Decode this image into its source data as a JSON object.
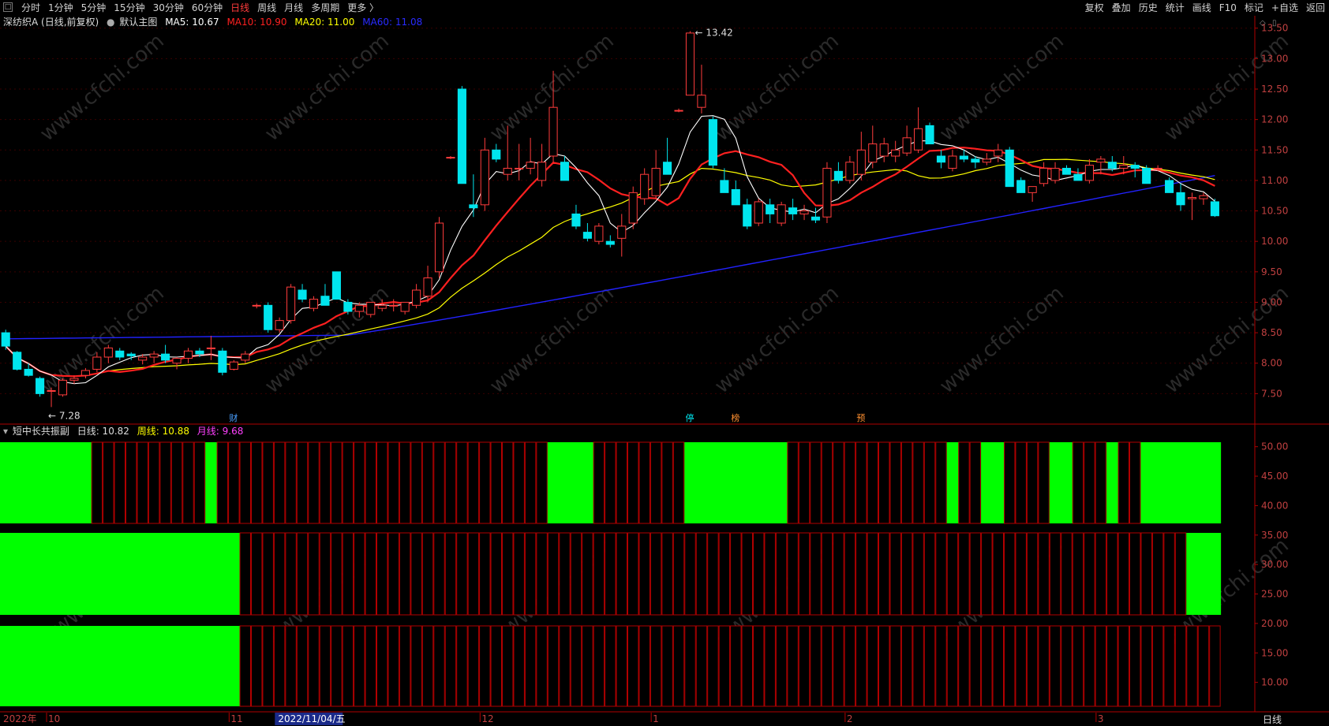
{
  "toolbar": {
    "left_items": [
      "分时",
      "1分钟",
      "5分钟",
      "15分钟",
      "30分钟",
      "60分钟",
      "日线",
      "周线",
      "月线",
      "多周期",
      "更多 〉"
    ],
    "active_item": "日线",
    "right_items": [
      "复权",
      "叠加",
      "历史",
      "统计",
      "画线",
      "F10",
      "标记",
      "+自选",
      "返回"
    ]
  },
  "main_info": {
    "title": "深纺织A (日线,前复权)",
    "template": "默认主图",
    "ma5": "MA5: 10.67",
    "ma10": "MA10: 10.90",
    "ma20": "MA20: 11.00",
    "ma60": "MA60: 11.08"
  },
  "sub_info": {
    "title": "短中长共振副",
    "daily": "日线: 10.82",
    "weekly": "周线: 10.88",
    "monthly": "月线: 9.68"
  },
  "colors": {
    "up": "#ff3c3c",
    "down": "#00e5ee",
    "ma5": "#ffffff",
    "ma10": "#ff2020",
    "ma20": "#ffff00",
    "ma60": "#2222ff",
    "signal": "#00ff00",
    "axis": "#b00000"
  },
  "chart_data": {
    "type": "candlestick",
    "y_ticks": [
      "13.50",
      "13.00",
      "12.50",
      "12.00",
      "11.50",
      "11.00",
      "10.50",
      "10.00",
      "9.50",
      "9.00",
      "8.50",
      "8.00",
      "7.50"
    ],
    "y_range": [
      7.0,
      13.6
    ],
    "annotations": {
      "high": "13.42",
      "low": "7.28"
    },
    "event_labels": [
      "财",
      "停",
      "榜",
      "预"
    ],
    "candles": [
      [
        8.5,
        8.55,
        8.22,
        8.28
      ],
      [
        8.18,
        8.2,
        7.88,
        7.9
      ],
      [
        7.9,
        8.0,
        7.78,
        7.8
      ],
      [
        7.75,
        7.78,
        7.45,
        7.5
      ],
      [
        7.55,
        7.6,
        7.28,
        7.55
      ],
      [
        7.48,
        7.75,
        7.45,
        7.72
      ],
      [
        7.72,
        7.8,
        7.66,
        7.75
      ],
      [
        7.8,
        7.92,
        7.75,
        7.88
      ],
      [
        7.9,
        8.18,
        7.85,
        8.1
      ],
      [
        8.1,
        8.3,
        8.0,
        8.25
      ],
      [
        8.2,
        8.25,
        8.05,
        8.1
      ],
      [
        8.15,
        8.18,
        8.05,
        8.12
      ],
      [
        8.05,
        8.15,
        7.98,
        8.1
      ],
      [
        8.1,
        8.2,
        8.0,
        8.15
      ],
      [
        8.15,
        8.3,
        8.0,
        8.05
      ],
      [
        8.0,
        8.1,
        7.9,
        8.08
      ],
      [
        8.08,
        8.25,
        8.0,
        8.2
      ],
      [
        8.2,
        8.25,
        8.1,
        8.15
      ],
      [
        8.25,
        8.45,
        8.05,
        8.25
      ],
      [
        8.2,
        8.25,
        7.8,
        7.85
      ],
      [
        7.9,
        8.05,
        7.88,
        8.02
      ],
      [
        8.05,
        8.2,
        8.0,
        8.15
      ],
      [
        8.95,
        8.98,
        8.9,
        8.95
      ],
      [
        8.95,
        9.0,
        8.5,
        8.55
      ],
      [
        8.55,
        8.75,
        8.5,
        8.7
      ],
      [
        8.7,
        9.3,
        8.65,
        9.25
      ],
      [
        9.2,
        9.3,
        9.0,
        9.05
      ],
      [
        8.9,
        9.1,
        8.85,
        9.05
      ],
      [
        9.1,
        9.3,
        8.95,
        8.95
      ],
      [
        9.5,
        9.5,
        9.05,
        9.05
      ],
      [
        9.0,
        9.05,
        8.8,
        8.85
      ],
      [
        8.85,
        9.0,
        8.75,
        8.95
      ],
      [
        8.8,
        9.0,
        8.75,
        9.0
      ],
      [
        8.9,
        9.05,
        8.85,
        8.95
      ],
      [
        8.95,
        9.05,
        8.85,
        8.95
      ],
      [
        8.85,
        9.0,
        8.8,
        9.0
      ],
      [
        8.95,
        9.3,
        8.9,
        9.2
      ],
      [
        9.1,
        9.6,
        9.0,
        9.4
      ],
      [
        9.5,
        10.4,
        9.4,
        10.3
      ],
      [
        11.38,
        11.4,
        11.35,
        11.38
      ],
      [
        12.5,
        12.55,
        11.0,
        10.95
      ],
      [
        10.6,
        11.1,
        10.4,
        10.55
      ],
      [
        10.6,
        11.7,
        10.5,
        11.5
      ],
      [
        11.5,
        11.6,
        11.3,
        11.35
      ],
      [
        11.1,
        11.9,
        11.0,
        11.2
      ],
      [
        11.2,
        11.6,
        11.0,
        11.2
      ],
      [
        11.2,
        11.7,
        11.1,
        11.3
      ],
      [
        11.0,
        11.6,
        10.9,
        11.3
      ],
      [
        11.4,
        12.8,
        11.3,
        12.2
      ],
      [
        11.3,
        11.4,
        11.0,
        11.0
      ],
      [
        10.45,
        10.6,
        10.2,
        10.25
      ],
      [
        10.15,
        10.3,
        10.0,
        10.05
      ],
      [
        10.0,
        10.3,
        9.95,
        10.25
      ],
      [
        10.0,
        10.1,
        9.9,
        9.95
      ],
      [
        10.05,
        10.45,
        9.75,
        10.25
      ],
      [
        10.3,
        10.9,
        10.2,
        10.8
      ],
      [
        10.7,
        11.2,
        10.6,
        11.1
      ],
      [
        10.75,
        11.5,
        10.7,
        11.2
      ],
      [
        11.3,
        11.7,
        11.1,
        11.1
      ],
      [
        12.15,
        12.18,
        12.12,
        12.15
      ],
      [
        12.4,
        13.45,
        12.4,
        13.42
      ],
      [
        12.2,
        12.9,
        12.1,
        12.4
      ],
      [
        12.0,
        12.05,
        11.2,
        11.25
      ],
      [
        11.0,
        11.2,
        10.8,
        10.8
      ],
      [
        10.85,
        11.0,
        10.6,
        10.6
      ],
      [
        10.6,
        10.7,
        10.2,
        10.25
      ],
      [
        10.3,
        10.7,
        10.25,
        10.65
      ],
      [
        10.6,
        10.7,
        10.3,
        10.45
      ],
      [
        10.3,
        10.65,
        10.25,
        10.6
      ],
      [
        10.55,
        10.7,
        10.35,
        10.45
      ],
      [
        10.45,
        10.6,
        10.35,
        10.5
      ],
      [
        10.4,
        10.55,
        10.3,
        10.35
      ],
      [
        10.4,
        11.3,
        10.3,
        11.2
      ],
      [
        11.15,
        11.3,
        10.95,
        11.0
      ],
      [
        11.0,
        11.4,
        10.95,
        11.3
      ],
      [
        11.1,
        11.8,
        11.0,
        11.5
      ],
      [
        11.3,
        11.9,
        11.2,
        11.6
      ],
      [
        11.4,
        11.7,
        11.3,
        11.6
      ],
      [
        11.4,
        11.65,
        11.3,
        11.5
      ],
      [
        11.45,
        11.9,
        11.4,
        11.7
      ],
      [
        11.5,
        12.2,
        11.45,
        11.85
      ],
      [
        11.9,
        11.95,
        11.6,
        11.6
      ],
      [
        11.4,
        11.5,
        11.2,
        11.3
      ],
      [
        11.2,
        11.5,
        11.15,
        11.4
      ],
      [
        11.4,
        11.5,
        11.3,
        11.35
      ],
      [
        11.35,
        11.4,
        11.2,
        11.3
      ],
      [
        11.3,
        11.45,
        11.25,
        11.35
      ],
      [
        11.4,
        11.6,
        11.3,
        11.5
      ],
      [
        11.5,
        11.55,
        10.9,
        10.9
      ],
      [
        11.0,
        11.05,
        10.8,
        10.8
      ],
      [
        10.8,
        10.9,
        10.65,
        10.9
      ],
      [
        10.95,
        11.3,
        10.9,
        11.2
      ],
      [
        11.0,
        11.3,
        10.95,
        11.2
      ],
      [
        11.2,
        11.25,
        11.1,
        11.1
      ],
      [
        11.1,
        11.2,
        11.0,
        11.0
      ],
      [
        11.0,
        11.35,
        10.95,
        11.25
      ],
      [
        11.3,
        11.4,
        11.1,
        11.35
      ],
      [
        11.3,
        11.4,
        11.15,
        11.2
      ],
      [
        11.2,
        11.4,
        11.1,
        11.25
      ],
      [
        11.25,
        11.3,
        11.05,
        11.2
      ],
      [
        11.2,
        11.25,
        10.95,
        10.95
      ],
      [
        11.2,
        11.25,
        11.15,
        11.2
      ],
      [
        11.0,
        11.05,
        10.8,
        10.8
      ],
      [
        10.8,
        10.95,
        10.5,
        10.6
      ],
      [
        10.7,
        10.8,
        10.35,
        10.72
      ],
      [
        10.7,
        10.8,
        10.6,
        10.75
      ],
      [
        10.65,
        10.7,
        10.4,
        10.42
      ]
    ],
    "x_labels": [
      {
        "label": "2022年",
        "index": 0
      },
      {
        "label": "10",
        "index": 4
      },
      {
        "label": "11",
        "index": 20
      },
      {
        "label": "12",
        "index": 42
      },
      {
        "label": "1",
        "index": 57
      },
      {
        "label": "2",
        "index": 74
      },
      {
        "label": "3",
        "index": 96
      }
    ],
    "cursor_date": "2022/11/04/五",
    "signal_ranges": {
      "daily": [
        [
          0,
          7
        ],
        [
          18,
          18
        ],
        [
          48,
          51
        ],
        [
          60,
          68
        ],
        [
          83,
          83
        ],
        [
          86,
          87
        ],
        [
          92,
          93
        ],
        [
          97,
          97
        ],
        [
          100,
          107
        ]
      ],
      "weekly": [
        [
          0,
          20
        ],
        [
          104,
          107
        ]
      ],
      "monthly": [
        [
          0,
          20
        ]
      ]
    },
    "sub_y_ticks": [
      "50.00",
      "45.00",
      "40.00",
      "35.00",
      "30.00",
      "25.00",
      "20.00",
      "15.00",
      "10.00"
    ]
  },
  "period_label": "日线",
  "watermark": "www.cfchi.com"
}
